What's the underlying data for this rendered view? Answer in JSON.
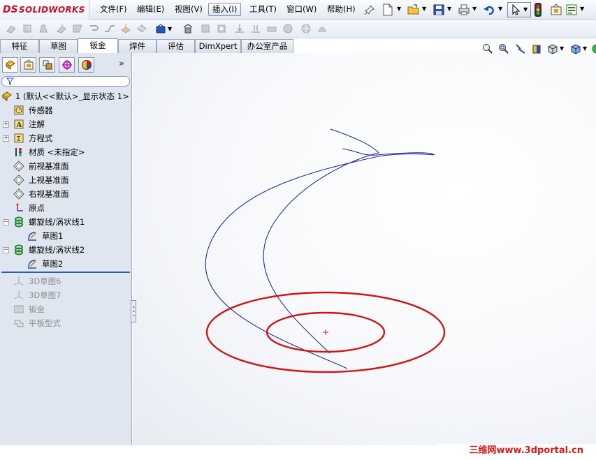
{
  "app": {
    "logo_prefix": "DS",
    "logo_name": "SOLIDWORKS"
  },
  "menu": {
    "items": [
      {
        "label": "文件(F)"
      },
      {
        "label": "编辑(E)"
      },
      {
        "label": "视图(V)"
      },
      {
        "label": "插入(I)",
        "active": true
      },
      {
        "label": "工具(T)"
      },
      {
        "label": "窗口(W)"
      },
      {
        "label": "帮助(H)"
      }
    ]
  },
  "command_tabs": [
    {
      "label": "特征"
    },
    {
      "label": "草图"
    },
    {
      "label": "钣金",
      "active": true
    },
    {
      "label": "焊件"
    },
    {
      "label": "评估"
    },
    {
      "label": "DimXpert"
    },
    {
      "label": "办公室产品"
    }
  ],
  "panel": {
    "collapse_glyph": "»"
  },
  "tree": {
    "root": "1  (默认<<默认>_显示状态 1>",
    "items": [
      {
        "label": "传感器",
        "icon": "sensor-icon"
      },
      {
        "label": "注解",
        "icon": "annotation-icon",
        "expandable": true
      },
      {
        "label": "方程式",
        "icon": "equation-icon",
        "expandable": true
      },
      {
        "label": "材质 <未指定>",
        "icon": "material-icon"
      },
      {
        "label": "前视基准面",
        "icon": "plane-icon"
      },
      {
        "label": "上视基准面",
        "icon": "plane-icon"
      },
      {
        "label": "右视基准面",
        "icon": "plane-icon"
      },
      {
        "label": "原点",
        "icon": "origin-icon"
      },
      {
        "label": "螺旋线/涡状线1",
        "icon": "helix-icon",
        "expandable": true
      },
      {
        "label": "草图1",
        "icon": "sketch-icon",
        "child": true
      },
      {
        "label": "螺旋线/涡状线2",
        "icon": "helix-icon",
        "expandable": true
      },
      {
        "label": "草图2",
        "icon": "sketch-icon",
        "child": true
      },
      {
        "label": "3D草图6",
        "icon": "3dsketch-icon",
        "suppressed": true
      },
      {
        "label": "3D草图7",
        "icon": "3dsketch-icon",
        "suppressed": true
      },
      {
        "label": "钣金",
        "icon": "sheetmetal-icon",
        "suppressed": true
      },
      {
        "label": "平板型式",
        "icon": "flatpattern-icon",
        "suppressed": true
      }
    ]
  },
  "colors": {
    "curve": "#1f2a9e",
    "circles": "#d01515",
    "accent": "#2e5fb8"
  },
  "watermark": "三维网www.3dportal.cn"
}
